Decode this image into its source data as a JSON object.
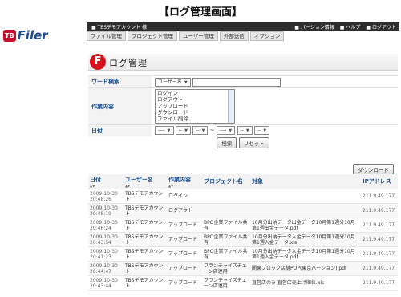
{
  "caption": "【ログ管理画面】",
  "logo": {
    "mark": "TB",
    "name": "Filer"
  },
  "topbar": {
    "account": "TBSデモアカウント 様",
    "links": [
      "バージョン情報",
      "ヘルプ",
      "ログアウト"
    ]
  },
  "menu": [
    "ファイル管理",
    "プロジェクト管理",
    "ユーザー管理",
    "外部送信",
    "オプション"
  ],
  "page_title": "ログ管理",
  "search": {
    "keyword_label": "ワード検索",
    "keyword_select": "ユーザー名",
    "keyword_value": "",
    "work_label": "作業内容",
    "work_options": [
      "ログイン",
      "ログアウト",
      "アップロード",
      "ダウンロード",
      "ファイル削除"
    ],
    "date_label": "日付",
    "date_selects": [
      "----",
      "--",
      "--",
      "----",
      "--",
      "--"
    ],
    "date_separator": "~",
    "search_button": "検索",
    "reset_button": "リセット"
  },
  "download_button": "ダウンロード",
  "table": {
    "headers": [
      "日付",
      "ユーザー名",
      "作業内容",
      "プロジェクト名",
      "対象",
      "IPアドレス"
    ],
    "rows": [
      {
        "date": "2009-10-30",
        "time": "20:48:26",
        "user": "TBSデモアカウント",
        "action": "ログイン",
        "project": "",
        "target": "",
        "ip": "211.9.49.177"
      },
      {
        "date": "2009-10-30",
        "time": "20:48:19",
        "user": "TBSデモアカウント",
        "action": "ログアウト",
        "project": "",
        "target": "",
        "ip": "211.9.49.177"
      },
      {
        "date": "2009-10-30",
        "time": "20:46:24",
        "user": "TBSデモアカウント",
        "action": "アップロード",
        "project": "BPO企業ファイル共有",
        "target": "10月分出納データ出金データ10月第1週分10月第1週出金データ.pdf",
        "ip": "211.9.49.177"
      },
      {
        "date": "2009-10-30",
        "time": "20:43:54",
        "user": "TBSデモアカウント",
        "action": "アップロード",
        "project": "BPO企業ファイル共有",
        "target": "10月分出納データ入金データ10月第1週分10月第1週入金データ.xls",
        "ip": "211.9.49.177"
      },
      {
        "date": "2009-10-30",
        "time": "20:41:23",
        "user": "TBSデモアカウント",
        "action": "アップロード",
        "project": "BPO企業ファイル共有",
        "target": "10月分出納データ入金データ10月第1週分10月第1週入金データ.pdf",
        "ip": "211.9.49.177"
      },
      {
        "date": "2009-10-30",
        "time": "20:44:47",
        "user": "TBSデモアカウント",
        "action": "アップロード",
        "project": "フランチャイズチェーン店連用",
        "target": "関東ブロック店舗POP(東京バージョン).pdf",
        "ip": "211.9.49.177"
      },
      {
        "date": "2009-10-30",
        "time": "20:43:44",
        "user": "TBSデモアカウント",
        "action": "アップロード",
        "project": "フランチャイズチェーン店連用",
        "target": "直営店のみ 直営店売上げ順位.xls",
        "ip": "211.9.49.177"
      }
    ]
  }
}
